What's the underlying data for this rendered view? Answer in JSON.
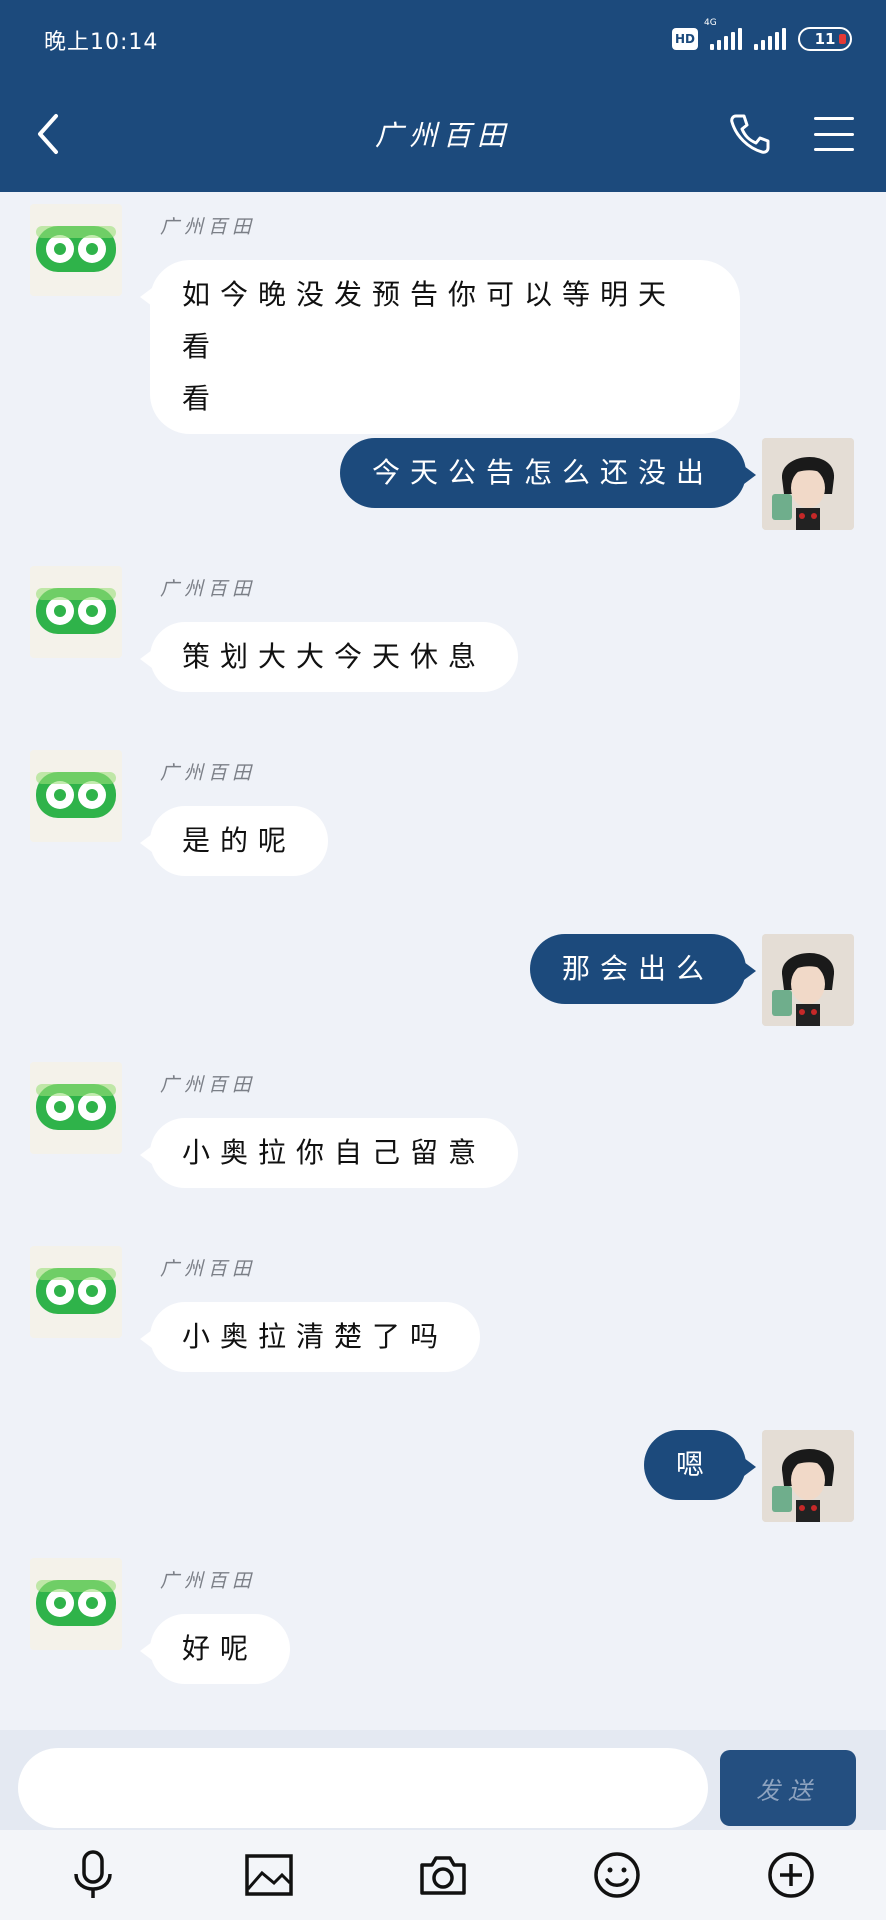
{
  "status_bar": {
    "time": "晚上10:14",
    "hd": "HD",
    "network": "4G",
    "battery": "11"
  },
  "header": {
    "title": "广州百田",
    "back_icon": "chevron-left-icon",
    "call_icon": "phone-icon",
    "menu_icon": "hamburger-menu-icon"
  },
  "messages": [
    {
      "side": "in",
      "sender": "广州百田",
      "text_line1": "如今晚没发预告你可以等明天看",
      "text_line2": "看"
    },
    {
      "side": "out",
      "text": "今天公告怎么还没出"
    },
    {
      "side": "in",
      "sender": "广州百田",
      "text": "策划大大今天休息"
    },
    {
      "side": "in",
      "sender": "广州百田",
      "text": "是的呢"
    },
    {
      "side": "out",
      "text": "那会出么"
    },
    {
      "side": "in",
      "sender": "广州百田",
      "text": "小奥拉你自己留意"
    },
    {
      "side": "in",
      "sender": "广州百田",
      "text": "小奥拉清楚了吗"
    },
    {
      "side": "out",
      "text": "嗯"
    },
    {
      "side": "in",
      "sender": "广州百田",
      "text": "好呢"
    }
  ],
  "composer": {
    "input_value": "",
    "send_label": "发送"
  },
  "toolbar": {
    "items": [
      "microphone-icon",
      "image-icon",
      "camera-icon",
      "emoji-icon",
      "plus-circle-icon"
    ]
  },
  "colors": {
    "header_bg": "#1c4a7c",
    "outgoing_bubble": "#1c4a7c",
    "incoming_bubble": "#ffffff",
    "chat_bg": "#eff2f8"
  }
}
